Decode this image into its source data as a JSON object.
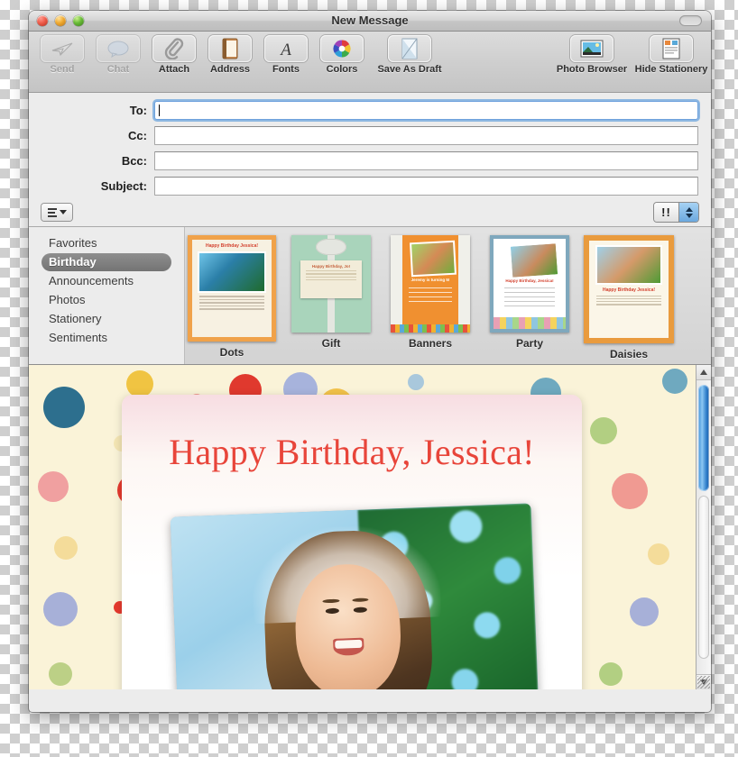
{
  "window": {
    "title": "New Message",
    "traffic_lights": [
      "close",
      "minimize",
      "zoom"
    ],
    "toolbar_toggle": "toolbar-pill"
  },
  "toolbar": {
    "items": [
      {
        "label": "Send",
        "icon": "paper-plane-icon",
        "enabled": false
      },
      {
        "label": "Chat",
        "icon": "speech-bubble-icon",
        "enabled": false
      },
      {
        "label": "Attach",
        "icon": "paperclip-icon",
        "enabled": true
      },
      {
        "label": "Address",
        "icon": "address-book-icon",
        "enabled": true
      },
      {
        "label": "Fonts",
        "icon": "font-a-icon",
        "enabled": true
      },
      {
        "label": "Colors",
        "icon": "color-wheel-icon",
        "enabled": true
      },
      {
        "label": "Save As Draft",
        "icon": "draft-page-icon",
        "enabled": true
      },
      {
        "label": "Photo Browser",
        "icon": "photo-icon",
        "enabled": true
      },
      {
        "label": "Hide Stationery",
        "icon": "stationery-icon",
        "enabled": true
      }
    ]
  },
  "headers": {
    "fields": [
      {
        "label": "To:",
        "value": "",
        "focused": true
      },
      {
        "label": "Cc:",
        "value": "",
        "focused": false
      },
      {
        "label": "Bcc:",
        "value": "",
        "focused": false
      },
      {
        "label": "Subject:",
        "value": "",
        "focused": false
      }
    ]
  },
  "optionbar": {
    "list_button": "format-list-dropdown",
    "priority_button": "!!",
    "stepper": "priority-stepper"
  },
  "stationery": {
    "categories": [
      {
        "label": "Favorites",
        "selected": false
      },
      {
        "label": "Birthday",
        "selected": true
      },
      {
        "label": "Announcements",
        "selected": false
      },
      {
        "label": "Photos",
        "selected": false
      },
      {
        "label": "Stationery",
        "selected": false
      },
      {
        "label": "Sentiments",
        "selected": false
      }
    ],
    "templates": [
      {
        "name": "Dots",
        "thumb_title": "Happy Birthday Jessica!"
      },
      {
        "name": "Gift",
        "thumb_title": "Happy Birthday, Jo!"
      },
      {
        "name": "Banners",
        "thumb_title": "Jeremy is turning 5!"
      },
      {
        "name": "Party",
        "thumb_title": "Happy Birthday, Jessica!"
      },
      {
        "name": "Daisies",
        "thumb_title": "Happy Birthday Jessica!"
      }
    ]
  },
  "message_body": {
    "heading": "Happy Birthday, Jessica!",
    "heading_color": "#e8453a",
    "background_color": "#faf3d8",
    "photo_alt": "smiling-girl-outdoors"
  },
  "scrollbar": {
    "up_arrow": "scroll-up-arrow",
    "down_arrow": "scroll-down-arrow",
    "thumb": "scroll-thumb"
  }
}
